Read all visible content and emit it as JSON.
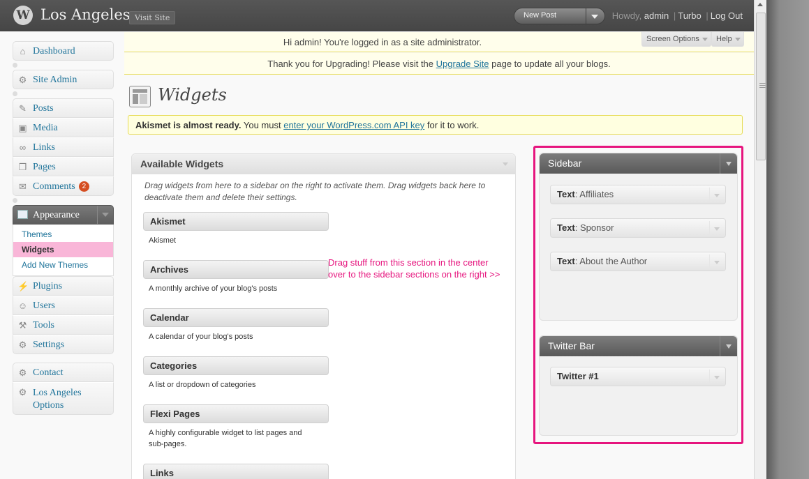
{
  "header": {
    "logo": "W",
    "site_title": "Los Angeles",
    "visit_site": "Visit Site",
    "new_post": "New Post",
    "howdy": "Howdy, ",
    "user": "admin",
    "turbo": "Turbo",
    "logout": "Log Out",
    "separator": "|"
  },
  "menu": {
    "dashboard": "Dashboard",
    "site_admin": "Site Admin",
    "posts": "Posts",
    "media": "Media",
    "links": "Links",
    "pages": "Pages",
    "comments": "Comments",
    "comments_count": "2",
    "appearance": "Appearance",
    "appearance_sub": {
      "themes": "Themes",
      "widgets": "Widgets",
      "add_new_themes": "Add New Themes"
    },
    "plugins": "Plugins",
    "users": "Users",
    "tools": "Tools",
    "settings": "Settings",
    "contact": "Contact",
    "la_options_line1": "Los Angeles",
    "la_options_line2": "Options"
  },
  "notices": {
    "admin_notice": "Hi admin! You're logged in as a site administrator.",
    "upgrade_before": "Thank you for Upgrading! Please visit the ",
    "upgrade_link": "Upgrade Site",
    "upgrade_after": " page to update all your blogs.",
    "screen_options": "Screen Options",
    "help": "Help",
    "akismet_bold": "Akismet is almost ready.",
    "akismet_before": " You must ",
    "akismet_link": "enter your WordPress.com API key",
    "akismet_after": " for it to work."
  },
  "page": {
    "title": "Widgets"
  },
  "available": {
    "title": "Available Widgets",
    "description": "Drag widgets from here to a sidebar on the right to activate them. Drag widgets back here to deactivate them and delete their settings.",
    "widgets": [
      {
        "title": "Akismet",
        "desc": "Akismet"
      },
      {
        "title": "Archives",
        "desc": "A monthly archive of your blog's posts"
      },
      {
        "title": "Calendar",
        "desc": "A calendar of your blog's posts"
      },
      {
        "title": "Categories",
        "desc": "A list or dropdown of categories"
      },
      {
        "title": "Flexi Pages",
        "desc": "A highly configurable widget to list pages and sub-pages."
      },
      {
        "title": "Links",
        "desc": ""
      }
    ]
  },
  "annotation": {
    "line1": "Drag stuff from this section in the center",
    "line2": "over to the sidebar sections on the right >>"
  },
  "sidebars": {
    "sidebar": {
      "title": "Sidebar",
      "widgets": [
        {
          "type": "Text",
          "name": ": Affiliates"
        },
        {
          "type": "Text",
          "name": ": Sponsor"
        },
        {
          "type": "Text",
          "name": ": About the Author"
        }
      ]
    },
    "twitter_bar": {
      "title": "Twitter Bar",
      "widgets": [
        {
          "type": "Twitter #1",
          "name": ""
        }
      ]
    }
  },
  "colors": {
    "annotation": "#e6157e",
    "link": "#21759b",
    "highlight": "#f9b6d8",
    "badge": "#d54e21"
  }
}
